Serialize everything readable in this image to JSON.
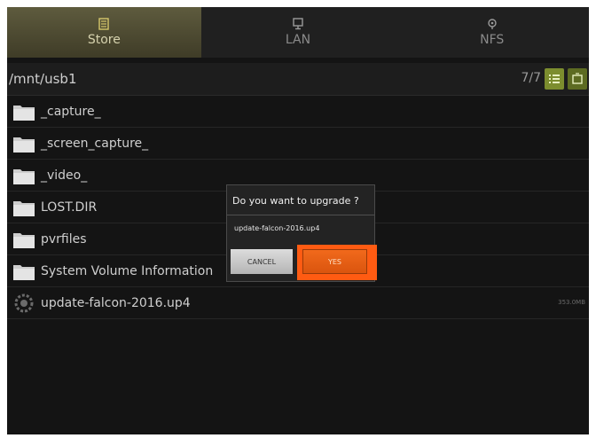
{
  "tabs": [
    {
      "label": "Store",
      "icon": "storage-icon",
      "active": true
    },
    {
      "label": "LAN",
      "icon": "monitor-icon",
      "active": false
    },
    {
      "label": "NFS",
      "icon": "network-share-icon",
      "active": false
    }
  ],
  "path": {
    "current": "/mnt/usb1",
    "count": "7/7"
  },
  "files": [
    {
      "name": "_capture_",
      "type": "folder"
    },
    {
      "name": "_screen_capture_",
      "type": "folder"
    },
    {
      "name": "_video_",
      "type": "folder"
    },
    {
      "name": "LOST.DIR",
      "type": "folder"
    },
    {
      "name": "pvrfiles",
      "type": "folder"
    },
    {
      "name": "System Volume Information",
      "type": "folder"
    },
    {
      "name": "update-falcon-2016.up4",
      "type": "file",
      "size": "353.0MB"
    }
  ],
  "dialog": {
    "title": "Do you want to upgrade ?",
    "message": "update-falcon-2016.up4",
    "cancel_label": "CANCEL",
    "yes_label": "YES"
  },
  "colors": {
    "accent": "#ff5b12",
    "tab_active": "#5e5b3e",
    "view_button": "#7c8d2e"
  }
}
